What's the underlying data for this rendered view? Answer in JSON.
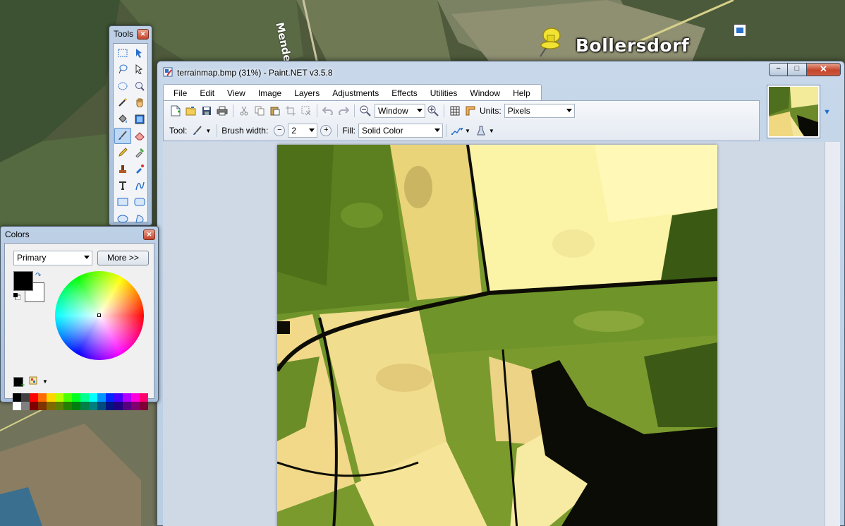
{
  "map": {
    "place_label": "Bollersdorf",
    "road_label": "Mendel"
  },
  "main_window": {
    "title": "terrainmap.bmp (31%) - Paint.NET v3.5.8",
    "menu": [
      "File",
      "Edit",
      "View",
      "Image",
      "Layers",
      "Adjustments",
      "Effects",
      "Utilities",
      "Window",
      "Help"
    ],
    "toolbar": {
      "zoom_value": "Window",
      "units_label": "Units:",
      "units_value": "Pixels",
      "tool_label": "Tool:",
      "brush_width_label": "Brush width:",
      "brush_width_value": "2",
      "fill_label": "Fill:",
      "fill_value": "Solid Color"
    }
  },
  "tools_window": {
    "title": "Tools"
  },
  "colors_window": {
    "title": "Colors",
    "mode_value": "Primary",
    "more_button": "More >>",
    "primary_color": "#000000",
    "secondary_color": "#ffffff",
    "palette_colors": [
      "#000000",
      "#404040",
      "#ff0000",
      "#ff6a00",
      "#ffd800",
      "#b6ff00",
      "#4cff00",
      "#00ff21",
      "#00ff90",
      "#00ffff",
      "#0094ff",
      "#0026ff",
      "#4800ff",
      "#b200ff",
      "#ff00dc",
      "#ff006e",
      "#ffffff",
      "#808080",
      "#7f0000",
      "#7f3300",
      "#7f6a00",
      "#5b7f00",
      "#267f00",
      "#007f0e",
      "#007f46",
      "#007f7f",
      "#004a7f",
      "#00137f",
      "#21007f",
      "#57007f",
      "#7f006e",
      "#7f0037"
    ]
  }
}
